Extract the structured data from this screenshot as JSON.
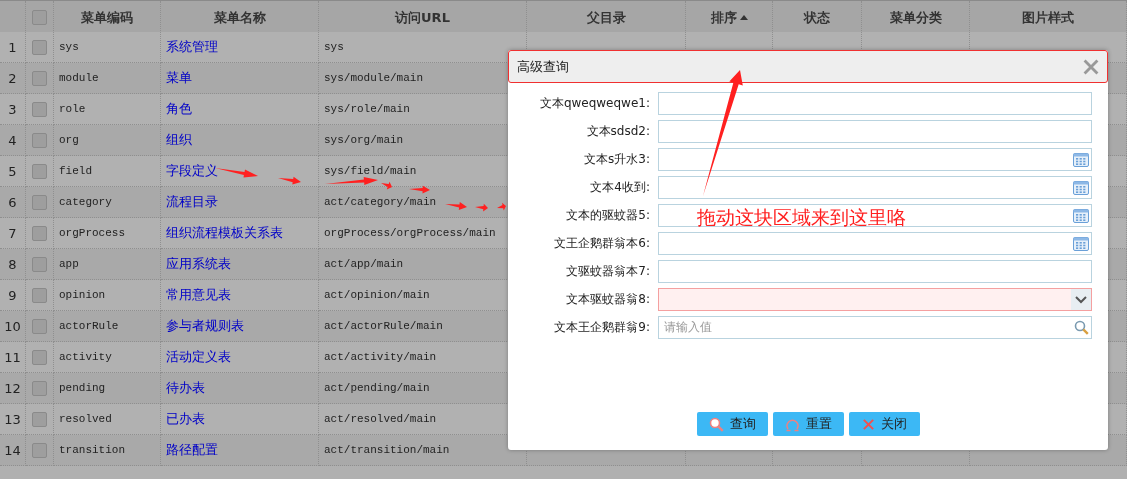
{
  "table": {
    "columns": [
      {
        "label": "菜单编码",
        "sorted": false
      },
      {
        "label": "菜单名称",
        "sorted": false
      },
      {
        "label": "访问URL",
        "sorted": false
      },
      {
        "label": "父目录",
        "sorted": false
      },
      {
        "label": "排序",
        "sorted": true
      },
      {
        "label": "状态",
        "sorted": false
      },
      {
        "label": "菜单分类",
        "sorted": false
      },
      {
        "label": "图片样式",
        "sorted": false
      }
    ],
    "header_checked": false,
    "rows": [
      {
        "index": "1",
        "checked": false,
        "cells": [
          "sys",
          "系统管理",
          "sys",
          "",
          "",
          "",
          "",
          ""
        ]
      },
      {
        "index": "2",
        "checked": false,
        "cells": [
          "module",
          "菜单",
          "sys/module/main",
          "",
          "",
          "",
          "",
          ""
        ]
      },
      {
        "index": "3",
        "checked": false,
        "cells": [
          "role",
          "角色",
          "sys/role/main",
          "",
          "",
          "",
          "",
          ""
        ]
      },
      {
        "index": "4",
        "checked": false,
        "cells": [
          "org",
          "组织",
          "sys/org/main",
          "",
          "",
          "",
          "",
          ""
        ]
      },
      {
        "index": "5",
        "checked": false,
        "cells": [
          "field",
          "字段定义",
          "sys/field/main",
          "",
          "",
          "",
          "",
          ""
        ]
      },
      {
        "index": "6",
        "checked": false,
        "cells": [
          "category",
          "流程目录",
          "act/category/main",
          "",
          "",
          "",
          "",
          ""
        ]
      },
      {
        "index": "7",
        "checked": false,
        "cells": [
          "orgProcess",
          "组织流程模板关系表",
          "orgProcess/orgProcess/main",
          "",
          "",
          "",
          "",
          ""
        ]
      },
      {
        "index": "8",
        "checked": false,
        "cells": [
          "app",
          "应用系统表",
          "act/app/main",
          "",
          "",
          "",
          "",
          ""
        ]
      },
      {
        "index": "9",
        "checked": false,
        "cells": [
          "opinion",
          "常用意见表",
          "act/opinion/main",
          "",
          "",
          "",
          "",
          ""
        ]
      },
      {
        "index": "10",
        "checked": false,
        "cells": [
          "actorRule",
          "参与者规则表",
          "act/actorRule/main",
          "",
          "",
          "",
          "",
          ""
        ]
      },
      {
        "index": "11",
        "checked": false,
        "cells": [
          "activity",
          "活动定义表",
          "act/activity/main",
          "",
          "",
          "",
          "",
          ""
        ]
      },
      {
        "index": "12",
        "checked": false,
        "cells": [
          "pending",
          "待办表",
          "act/pending/main",
          "",
          "",
          "",
          "",
          ""
        ]
      },
      {
        "index": "13",
        "checked": false,
        "cells": [
          "resolved",
          "已办表",
          "act/resolved/main",
          "",
          "",
          "",
          "",
          ""
        ]
      },
      {
        "index": "14",
        "checked": false,
        "cells": [
          "transition",
          "路径配置",
          "act/transition/main",
          "",
          "",
          "",
          "",
          ""
        ]
      }
    ]
  },
  "dialog": {
    "title": "高级查询",
    "fields": [
      {
        "label": "文本qweqweqwe1:",
        "kind": "text",
        "invalid": false
      },
      {
        "label": "文本sdsd2:",
        "kind": "text",
        "invalid": false
      },
      {
        "label": "文本s升水3:",
        "kind": "date",
        "invalid": false
      },
      {
        "label": "文本4收到:",
        "kind": "date",
        "invalid": false
      },
      {
        "label": "文本的驱蚊器5:",
        "kind": "date",
        "invalid": false
      },
      {
        "label": "文王企鹅群翁本6:",
        "kind": "date",
        "invalid": false
      },
      {
        "label": "文驱蚊器翁本7:",
        "kind": "text",
        "invalid": false
      },
      {
        "label": "文本驱蚊器翁8:",
        "kind": "select",
        "invalid": true
      },
      {
        "label": "文本王企鹅群翁9:",
        "kind": "search",
        "invalid": false,
        "placeholder": "请输入值"
      }
    ],
    "buttons": [
      {
        "label": "查询",
        "kind": "search"
      },
      {
        "label": "重置",
        "kind": "reset"
      },
      {
        "label": "关闭",
        "kind": "close"
      }
    ]
  },
  "annotation": {
    "text": "拖动这块区域来到这里咯"
  }
}
